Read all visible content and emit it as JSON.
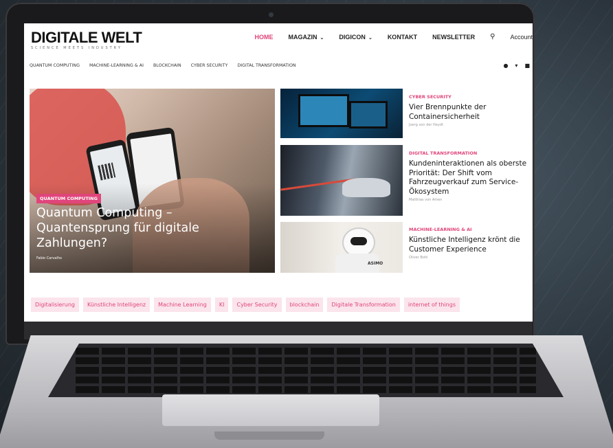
{
  "site": {
    "logo": "DIGITALE WELT",
    "tagline": "SCIENCE MEETS INDUSTRY",
    "accent_color": "#e0457b"
  },
  "nav": {
    "items": [
      {
        "label": "HOME",
        "active": true
      },
      {
        "label": "MAGAZIN",
        "has_dropdown": true
      },
      {
        "label": "DIGICON",
        "has_dropdown": true
      },
      {
        "label": "KONTAKT"
      },
      {
        "label": "NEWSLETTER"
      }
    ],
    "search_icon": "search-icon",
    "account_label": "Account"
  },
  "categories": [
    "QUANTUM COMPUTING",
    "MACHINE-LEARNING & AI",
    "BLOCKCHAIN",
    "CYBER SECURITY",
    "DIGITAL TRANSFORMATION"
  ],
  "social": [
    "facebook-icon",
    "twitter-icon",
    "linkedin-icon"
  ],
  "hero": {
    "category": "QUANTUM COMPUTING",
    "title": "Quantum Computing – Quantensprung für digitale Zahlungen?",
    "author": "Fabio Carvalho"
  },
  "articles": [
    {
      "category": "CYBER SECURITY",
      "title": "Vier Brennpunkte der Containersicherheit",
      "author": "Joerg von der Heydt"
    },
    {
      "category": "DIGITAL TRANSFORMATION",
      "title": "Kundeninteraktionen als oberste Priorität: Der Shift vom Fahrzeugverkauf zum Service-Ökosystem",
      "author": "Matthias von Amen"
    },
    {
      "category": "MACHINE-LEARNING & AI",
      "title": "Künstliche Intelligenz krönt die Customer Experience",
      "author": "Oliver Bohl"
    }
  ],
  "tags": [
    "Digitalisierung",
    "Künstliche Intelligenz",
    "Machine Learning",
    "KI",
    "Cyber Security",
    "blockchain",
    "Digitale Transformation",
    "internet of things"
  ]
}
